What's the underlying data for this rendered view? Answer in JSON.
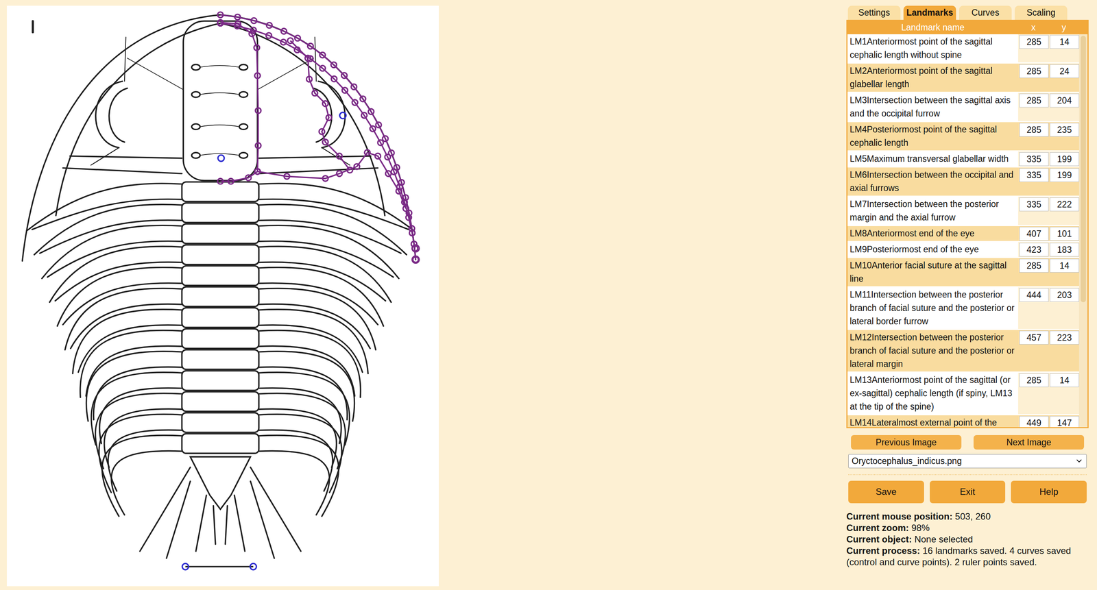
{
  "tabs": [
    {
      "label": "Settings",
      "selected": false
    },
    {
      "label": "Landmarks",
      "selected": true
    },
    {
      "label": "Curves",
      "selected": false
    },
    {
      "label": "Scaling",
      "selected": false
    }
  ],
  "table": {
    "columns": [
      "Landmark name",
      "x",
      "y"
    ],
    "rows": [
      {
        "name": "LM1Anteriormost point of the sagittal cephalic length without spine",
        "x": "285",
        "y": "14"
      },
      {
        "name": "LM2Anteriormost point of the sagittal glabellar length",
        "x": "285",
        "y": "24"
      },
      {
        "name": "LM3Intersection between the sagittal axis and the occipital furrow",
        "x": "285",
        "y": "204"
      },
      {
        "name": "LM4Posteriormost point of the sagittal cephalic length",
        "x": "285",
        "y": "235"
      },
      {
        "name": "LM5Maximum transversal glabellar width",
        "x": "335",
        "y": "199"
      },
      {
        "name": "LM6Intersection between the occipital and axial furrows",
        "x": "335",
        "y": "199"
      },
      {
        "name": "LM7Intersection between the posterior margin and the axial furrow",
        "x": "335",
        "y": "222"
      },
      {
        "name": "LM8Anteriormost end of the eye",
        "x": "407",
        "y": "101"
      },
      {
        "name": "LM9Posteriormost end of the eye",
        "x": "423",
        "y": "183"
      },
      {
        "name": "LM10Anterior facial suture at the sagittal line",
        "x": "285",
        "y": "14"
      },
      {
        "name": "LM11Intersection between the posterior branch of facial suture and the posterior or lateral border furrow",
        "x": "444",
        "y": "203"
      },
      {
        "name": "LM12Intersection between the posterior branch of facial suture and the posterior or lateral margin",
        "x": "457",
        "y": "223"
      },
      {
        "name": "LM13Anteriormost point of the sagittal (or ex-sagittal) cephalic length (if spiny, LM13 at the tip of the spine)",
        "x": "285",
        "y": "14"
      },
      {
        "name": "LM14Lateralmost external point of the",
        "x": "449",
        "y": "147"
      }
    ]
  },
  "navigation": [
    "Previous Image",
    "Next Image"
  ],
  "image_select": {
    "value": "Oryctocephalus_indicus.png"
  },
  "buttons": [
    "Save",
    "Exit",
    "Help"
  ],
  "status": [
    {
      "label": "Current mouse position:",
      "value": "503, 260"
    },
    {
      "label": "Current zoom:",
      "value": "98%"
    },
    {
      "label": "Current object:",
      "value": "None selected"
    },
    {
      "label": "Current process:",
      "value": "16 landmarks saved. 4 curves saved (control and curve points). 2 ruler points saved."
    }
  ]
}
